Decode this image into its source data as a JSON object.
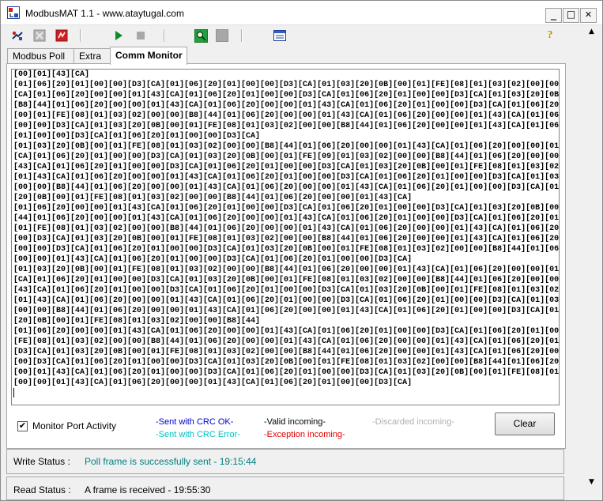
{
  "window": {
    "title": "ModbusMAT 1.1  -  www.ataytugal.com",
    "minimize": "_",
    "maximize": "□",
    "close": "✕"
  },
  "toolbar": {
    "help_glyph": "?"
  },
  "tabs": [
    {
      "label": "Modbus Poll"
    },
    {
      "label": "Extra"
    },
    {
      "label": "Comm Monitor",
      "active": true
    }
  ],
  "monitor": {
    "log_lines": [
      "[00][01][43][CA]",
      "[01][06][20][01][00][00][D3][CA][01][06][20][01][00][00][D3][CA][01][03][20][0B][00][01][FE][08][01][03][02][00][00][B8][44]",
      "[CA][01][06][20][00][00][01][43][CA][01][06][20][01][00][00][D3][CA][01][06][20][01][00][00][D3][CA][01][03][20][0B][00][01]",
      "[B8][44][01][06][20][00][00][01][43][CA][01][06][20][00][00][01][43][CA][01][06][20][01][00][00][D3][CA][01][06][20][01][00]",
      "[00][01][FE][08][01][03][02][00][00][B8][44][01][06][20][00][00][01][43][CA][01][06][20][00][00][01][43][CA][01][06][20][01]",
      "[00][00][D3][CA][01][03][20][0B][00][01][FE][08][01][03][02][00][00][B8][44][01][06][20][00][00][01][43][CA][01][06][20][00]",
      "[01][00][00][D3][CA][01][06][20][01][00][00][D3][CA]",
      "[01][03][20][0B][00][01][FE][08][01][03][02][00][00][B8][44][01][06][20][00][00][01][43][CA][01][06][20][00][00][01][43][CA]",
      "[CA][01][06][20][01][00][00][D3][CA][01][03][20][0B][00][01][FE][09][01][03][02][00][00][B8][44][01][06][20][00][00][01][43]",
      "[43][CA][01][06][20][01][00][00][D3][CA][01][06][20][01][00][00][D3][CA][01][03][20][0B][00][01][FE][08][01][03][02][00][00]",
      "[01][43][CA][01][06][20][00][00][01][43][CA][01][06][20][01][00][00][D3][CA][01][06][20][01][00][00][D3][CA][01][03][20][0B]",
      "[00][00][B8][44][01][06][20][00][00][01][43][CA][01][06][20][00][00][01][43][CA][01][06][20][01][00][00][D3][CA][01][06][20]",
      "[20][0B][00][01][FE][08][01][03][02][00][00][B8][44][01][06][20][00][00][01][43][CA]",
      "[01][06][20][00][00][01][43][CA][01][06][20][01][00][00][D3][CA][01][06][20][01][00][00][D3][CA][01][03][20][0B][00][01][FE]",
      "[44][01][06][20][00][00][01][43][CA][01][06][20][00][00][01][43][CA][01][06][20][01][00][00][D3][CA][01][06][20][01][00][00]",
      "[01][FE][08][01][03][02][00][00][B8][44][01][06][20][00][00][01][43][CA][01][06][20][00][00][01][43][CA][01][06][20][01][00]",
      "[00][D3][CA][01][03][20][0B][00][01][FE][08][01][03][02][00][00][B8][44][01][06][20][00][00][01][43][CA][01][06][20][00][00]",
      "[00][00][D3][CA][01][06][20][01][00][00][D3][CA][01][03][20][0B][00][01][FE][08][01][03][02][00][00][B8][44][01][06][20][00]",
      "[00][00][01][43][CA][01][06][20][01][00][00][D3][CA][01][06][20][01][00][00][D3][CA]",
      "[01][03][20][0B][00][01][FE][08][01][03][02][00][00][B8][44][01][06][20][00][00][01][43][CA][01][06][20][00][00][01][43][CA]",
      "[CA][01][06][20][01][00][00][D3][CA][01][03][20][0B][00][01][FE][08][01][03][02][00][00][B8][44][01][06][20][00][00][01][43]",
      "[43][CA][01][06][20][01][00][00][D3][CA][01][06][20][01][00][00][D3][CA][01][03][20][0B][00][01][FE][08][01][03][02][00][00]",
      "[01][43][CA][01][06][20][00][00][01][43][CA][01][06][20][01][00][00][D3][CA][01][06][20][01][00][00][D3][CA][01][03][20][0B]",
      "[00][00][B8][44][01][06][20][00][00][01][43][CA][01][06][20][00][00][01][43][CA][01][06][20][01][00][00][D3][CA][01][06][20]",
      "[20][0B][00][01][FE][08][01][03][02][00][00][B8][44]",
      "[01][06][20][00][00][01][43][CA][01][06][20][00][00][01][43][CA][01][06][20][01][00][00][D3][CA][01][06][20][01][00][00][D3]",
      "[FE][08][01][03][02][00][00][B8][44][01][06][20][00][00][01][43][CA][01][06][20][00][00][01][43][CA][01][06][20][01][00][00]",
      "[D3][CA][01][03][20][0B][00][01][FE][08][01][03][02][00][00][B8][44][01][06][20][00][00][01][43][CA][01][06][20][00][00][01]",
      "[00][D3][CA][01][06][20][01][00][00][D3][CA][01][03][20][0B][00][01][FE][08][01][03][02][00][00][B8][44][01][06][20][00][00]",
      "[00][01][43][CA][01][06][20][01][00][00][D3][CA][01][06][20][01][00][00][D3][CA][01][03][20][0B][00][01][FE][08][01][03][02]",
      "[00][00][01][43][CA][01][06][20][00][00][01][43][CA][01][06][20][01][00][00][D3][CA]"
    ],
    "monitor_port_activity_label": "Monitor Port Activity",
    "monitor_port_activity_checked": "✔",
    "legend": {
      "sent_ok": "-Sent with CRC OK-",
      "sent_error": "-Sent with CRC Error-",
      "valid": "-Valid incoming-",
      "exception": "-Exception incoming-",
      "discarded": "-Discarded incoming-"
    },
    "clear_button": "Clear"
  },
  "colors": {
    "sent_ok": "#0000cc",
    "sent_error": "#00c0c0",
    "valid": "#000000",
    "exception": "#e00000",
    "discarded": "#b0b0b0",
    "write_status_value": "#008080"
  },
  "status": {
    "write_label": "Write Status :",
    "write_value": "Poll frame is successfully sent - 19:15:44",
    "read_label": "Read Status :",
    "read_value": "A frame is received - 19:55:30"
  }
}
